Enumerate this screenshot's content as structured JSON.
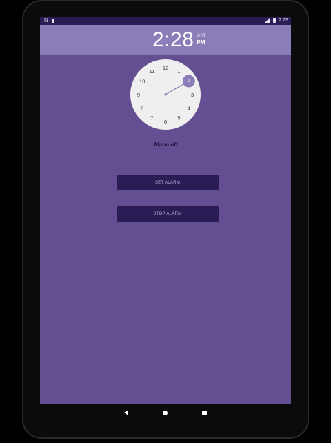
{
  "status_bar": {
    "left_icons": [
      "n-notification-icon",
      "sd-card-icon"
    ],
    "right_icons": [
      "signal-icon",
      "battery-icon"
    ],
    "time": "2:29"
  },
  "header": {
    "time": "2:28",
    "am_label": "AM",
    "pm_label": "PM",
    "selected_period": "PM"
  },
  "clock": {
    "numbers": [
      "12",
      "1",
      "2",
      "3",
      "4",
      "5",
      "6",
      "7",
      "8",
      "9",
      "10",
      "11"
    ],
    "selected_hour": "2",
    "colors": {
      "face": "#efefef",
      "accent": "#8a7db8",
      "hand": "#8a7db8"
    }
  },
  "alarm": {
    "status": "Alarm off",
    "set_label": "SET ALARM",
    "stop_label": "STOP ALARM"
  },
  "nav": {
    "icons": [
      "back-icon",
      "home-icon",
      "recents-icon"
    ]
  },
  "colors": {
    "background": "#634f91",
    "header": "#8a7db8",
    "statusbar": "#2a1d56",
    "button": "#2a1d56"
  }
}
